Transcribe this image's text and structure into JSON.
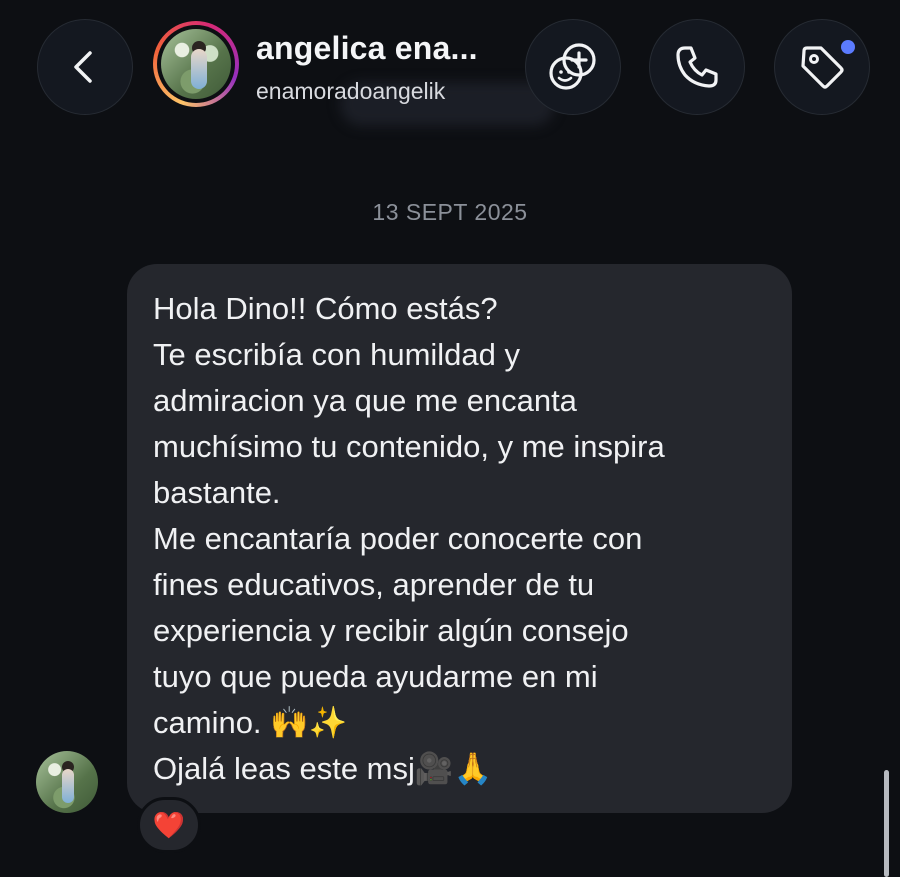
{
  "header": {
    "contact_name": "angelica ena...",
    "contact_handle": "enamoradoangelik"
  },
  "conversation": {
    "date_separator": "13 SEPT 2025",
    "message": {
      "line1": "Hola Dino!! Cómo estás?",
      "line2": "Te escribía con humildad y\nadmiracion ya que me encanta\nmuchísimo tu contenido, y me inspira\nbastante.",
      "line3": "Me encantaría poder conocerte con\nfines educativos, aprender de tu\nexperiencia y recibir algún consejo\ntuyo que pueda ayudarme en mi\ncamino. 🙌✨",
      "line4": "Ojalá leas este msj🎥🙏"
    },
    "reaction": "❤️"
  },
  "icons": {
    "back": "chevron-left-icon",
    "effects": "effects-add-icon",
    "call": "phone-icon",
    "tag": "tag-icon"
  },
  "colors": {
    "background": "#0d0f13",
    "bubble": "#25272d",
    "notification_dot": "#5b7bff"
  }
}
